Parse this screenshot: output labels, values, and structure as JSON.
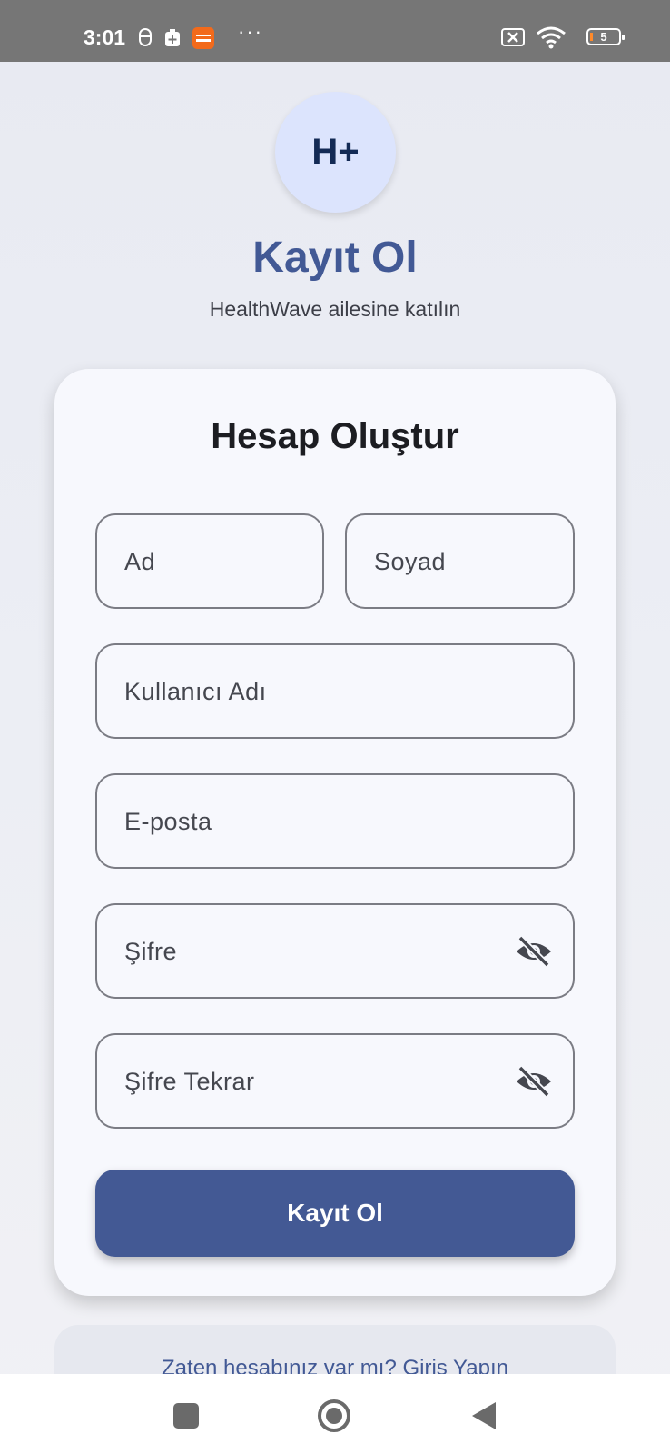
{
  "status_bar": {
    "time": "3:01",
    "app_icons": [
      "notification-icon",
      "medical-app-icon",
      "temu-icon"
    ],
    "more": "···",
    "battery_level": "5"
  },
  "header": {
    "logo_text": "H+",
    "title": "Kayıt Ol",
    "subtitle": "HealthWave ailesine katılın"
  },
  "form": {
    "title": "Hesap Oluştur",
    "first_name_label": "Ad",
    "last_name_label": "Soyad",
    "username_label": "Kullanıcı Adı",
    "email_label": "E-posta",
    "password_label": "Şifre",
    "password_confirm_label": "Şifre Tekrar",
    "submit_label": "Kayıt Ol"
  },
  "footer": {
    "login_link": "Zaten hesabınız var mı? Giriş Yapın"
  },
  "colors": {
    "accent": "#435994",
    "logo_bg": "#dce4fd",
    "card_bg": "#f7f8fd"
  }
}
